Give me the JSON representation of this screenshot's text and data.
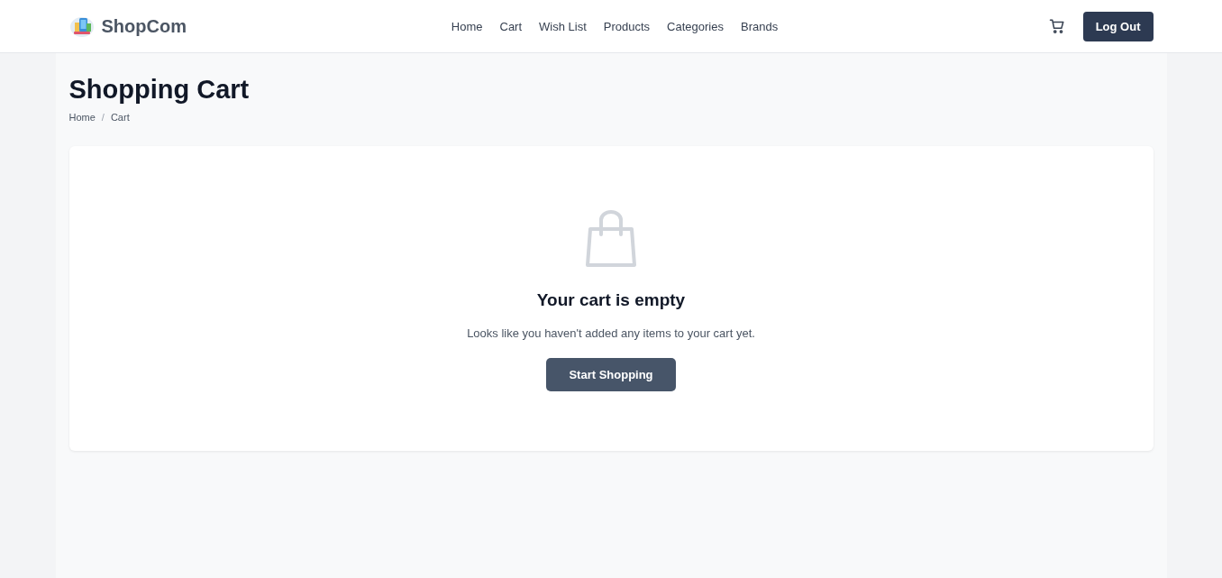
{
  "header": {
    "brand": "ShopCom",
    "nav": [
      "Home",
      "Cart",
      "Wish List",
      "Products",
      "Categories",
      "Brands"
    ],
    "logout_button": "Log Out"
  },
  "page": {
    "title": "Shopping Cart",
    "breadcrumb": [
      "Home",
      "Cart"
    ],
    "breadcrumb_separator": "/"
  },
  "empty_cart": {
    "heading": "Your cart is empty",
    "message": "Looks like you haven't added any items to your cart yet.",
    "button": "Start Shopping"
  }
}
